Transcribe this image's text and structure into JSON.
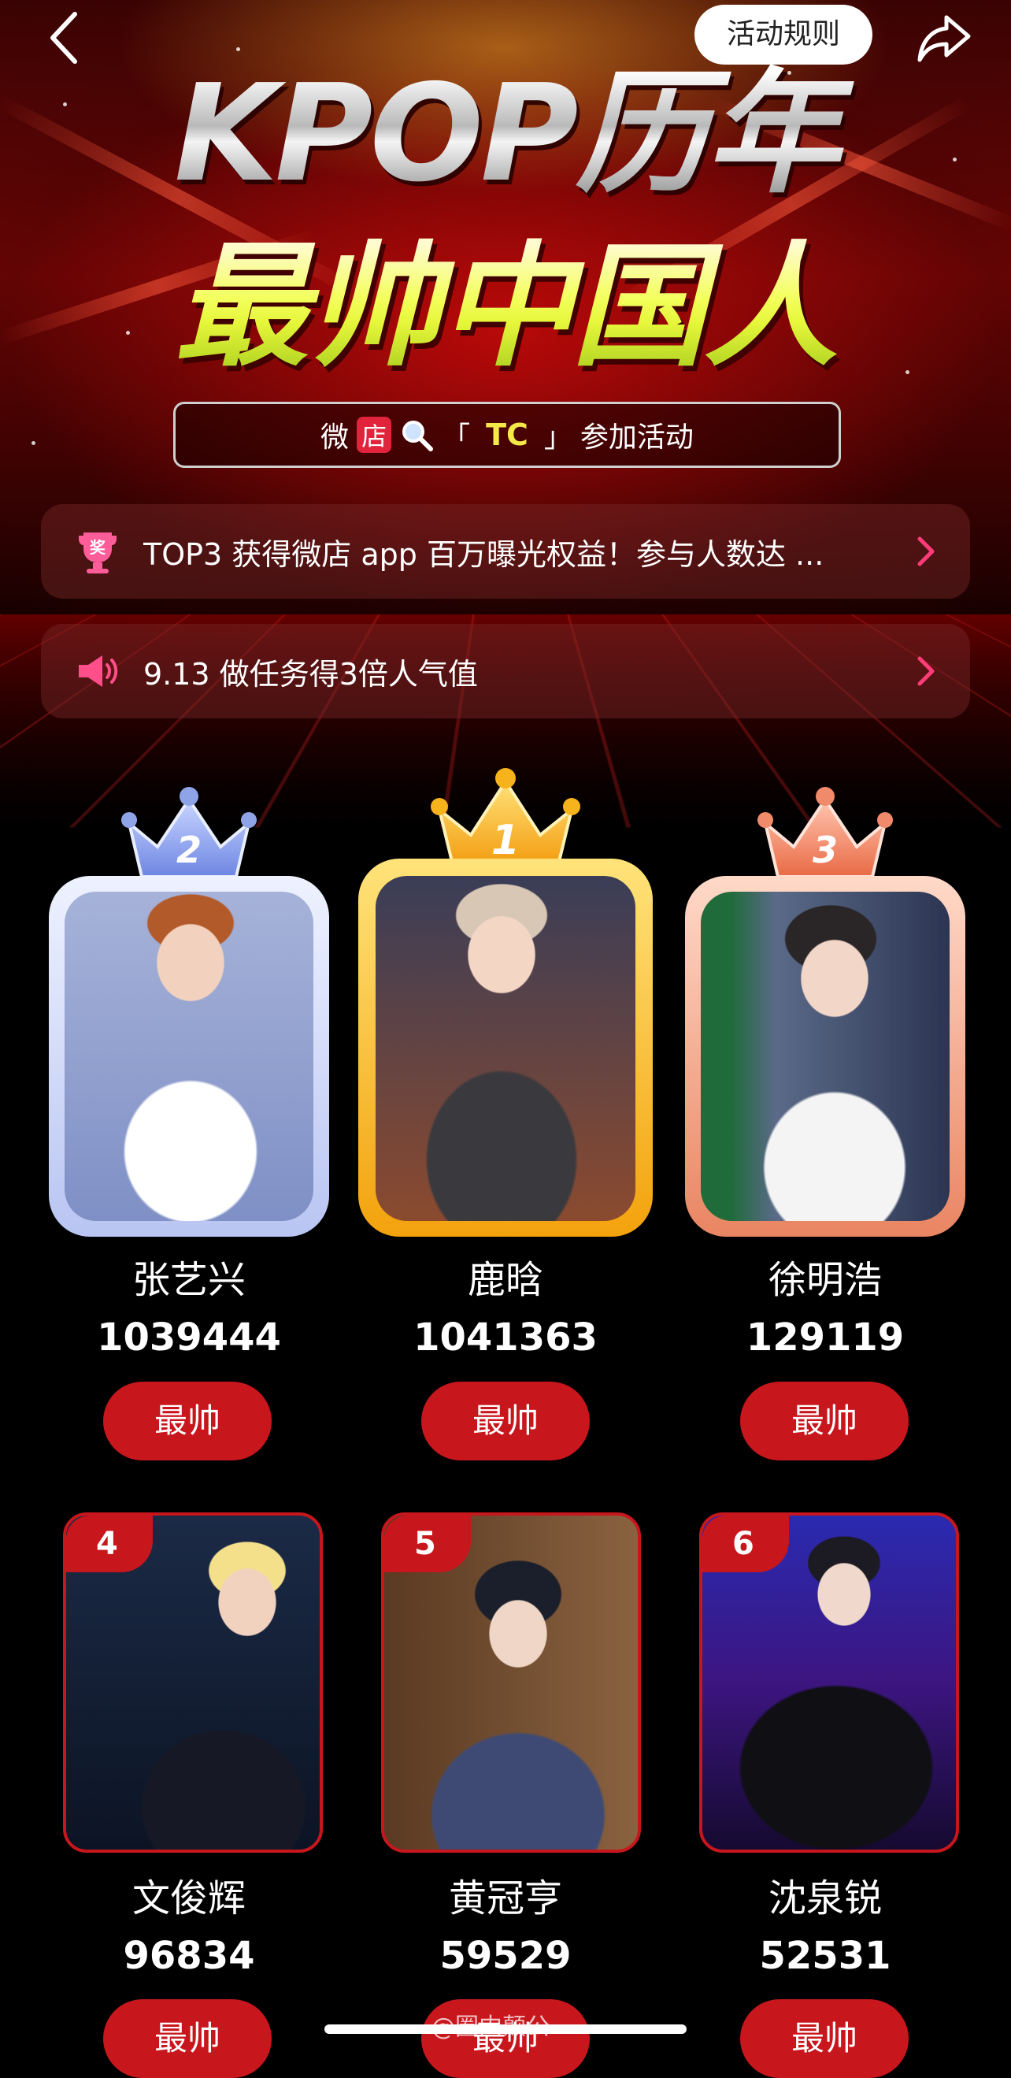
{
  "header": {
    "rules_label": "活动规则",
    "title_line1": "KPOP历年",
    "title_line2": "最帅中国人"
  },
  "search": {
    "shop_prefix": "微",
    "shop_badge": "店",
    "open_bracket": "「",
    "keyword": "TC",
    "close_bracket": "」",
    "suffix": "参加活动"
  },
  "notices": [
    {
      "icon": "trophy-icon",
      "text": "TOP3 获得微店 app 百万曝光权益！参与人数达 ..."
    },
    {
      "icon": "megaphone-icon",
      "text": "9.13 做任务得3倍人气值"
    }
  ],
  "vote_label": "最帅",
  "podium": [
    {
      "rank": "2",
      "name": "张艺兴",
      "score": "1039444",
      "tier": "silver"
    },
    {
      "rank": "1",
      "name": "鹿晗",
      "score": "1041363",
      "tier": "gold"
    },
    {
      "rank": "3",
      "name": "徐明浩",
      "score": "129119",
      "tier": "bronze"
    }
  ],
  "ranked": [
    {
      "rank": "4",
      "name": "文俊辉",
      "score": "96834"
    },
    {
      "rank": "5",
      "name": "黄冠亨",
      "score": "59529"
    },
    {
      "rank": "6",
      "name": "沈泉锐",
      "score": "52531"
    }
  ],
  "watermark": "@圈内颠公",
  "colors": {
    "accent_red": "#c8161d",
    "gold": "#f7b31c",
    "silver": "#8fa4e6",
    "bronze": "#f08a6a",
    "title_yellow": "#e5f63a"
  }
}
